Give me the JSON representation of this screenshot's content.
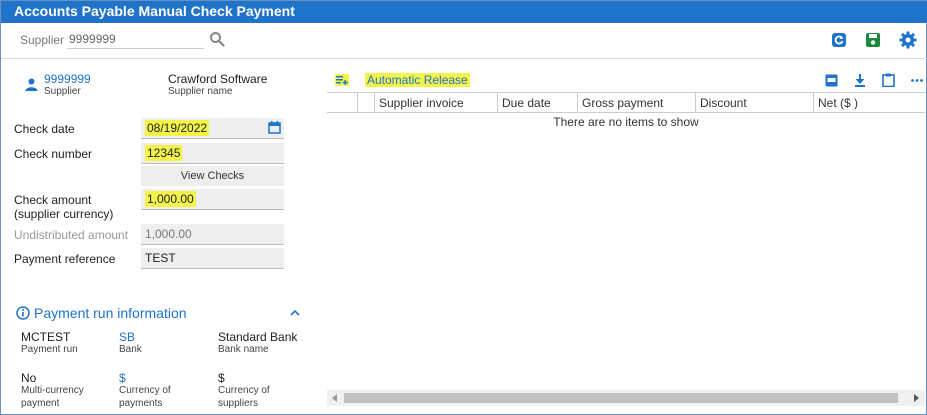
{
  "window": {
    "title": "Accounts Payable Manual Check Payment"
  },
  "toolbar": {
    "supplier_label": "Supplier",
    "supplier_value": "9999999",
    "icons": [
      "search-icon",
      "refresh-icon",
      "save-icon",
      "gear-icon"
    ],
    "accent_color": "#1f73c9",
    "save_color": "#1c8a3e"
  },
  "supplier": {
    "id": "9999999",
    "id_caption": "Supplier",
    "name": "Crawford Software",
    "name_caption": "Supplier name"
  },
  "form": {
    "check_date_label": "Check date",
    "check_date_value": "08/19/2022",
    "check_number_label": "Check number",
    "check_number_value": "12345",
    "view_checks_label": "View Checks",
    "check_amount_label_1": "Check amount",
    "check_amount_label_2": "(supplier currency)",
    "check_amount_value": "1,000.00",
    "undistributed_label": "Undistributed amount",
    "undistributed_value": "1,000.00",
    "payment_ref_label": "Payment reference",
    "payment_ref_value": "TEST",
    "highlight_color": "#f4f34a"
  },
  "payment_run": {
    "section_title": "Payment run information",
    "run_value": "MCTEST",
    "run_caption": "Payment run",
    "bank_value": "SB",
    "bank_caption": "Bank",
    "bank_name_value": "Standard Bank",
    "bank_name_caption": "Bank name",
    "multi_currency_value": "No",
    "multi_currency_caption_1": "Multi-currency",
    "multi_currency_caption_2": "payment",
    "currency_payments_value": "$",
    "currency_payments_caption_1": "Currency of",
    "currency_payments_caption_2": "payments",
    "currency_suppliers_value": "$",
    "currency_suppliers_caption_1": "Currency of",
    "currency_suppliers_caption_2": "suppliers"
  },
  "grid": {
    "automatic_release_label": "Automatic Release",
    "columns": [
      "Supplier invoice",
      "Due date",
      "Gross payment",
      "Discount",
      "Net ($ )"
    ],
    "empty_message": "There are no items to show",
    "toolbar_icons": [
      "pdf-icon",
      "download-icon",
      "clipboard-icon",
      "more-icon"
    ]
  }
}
